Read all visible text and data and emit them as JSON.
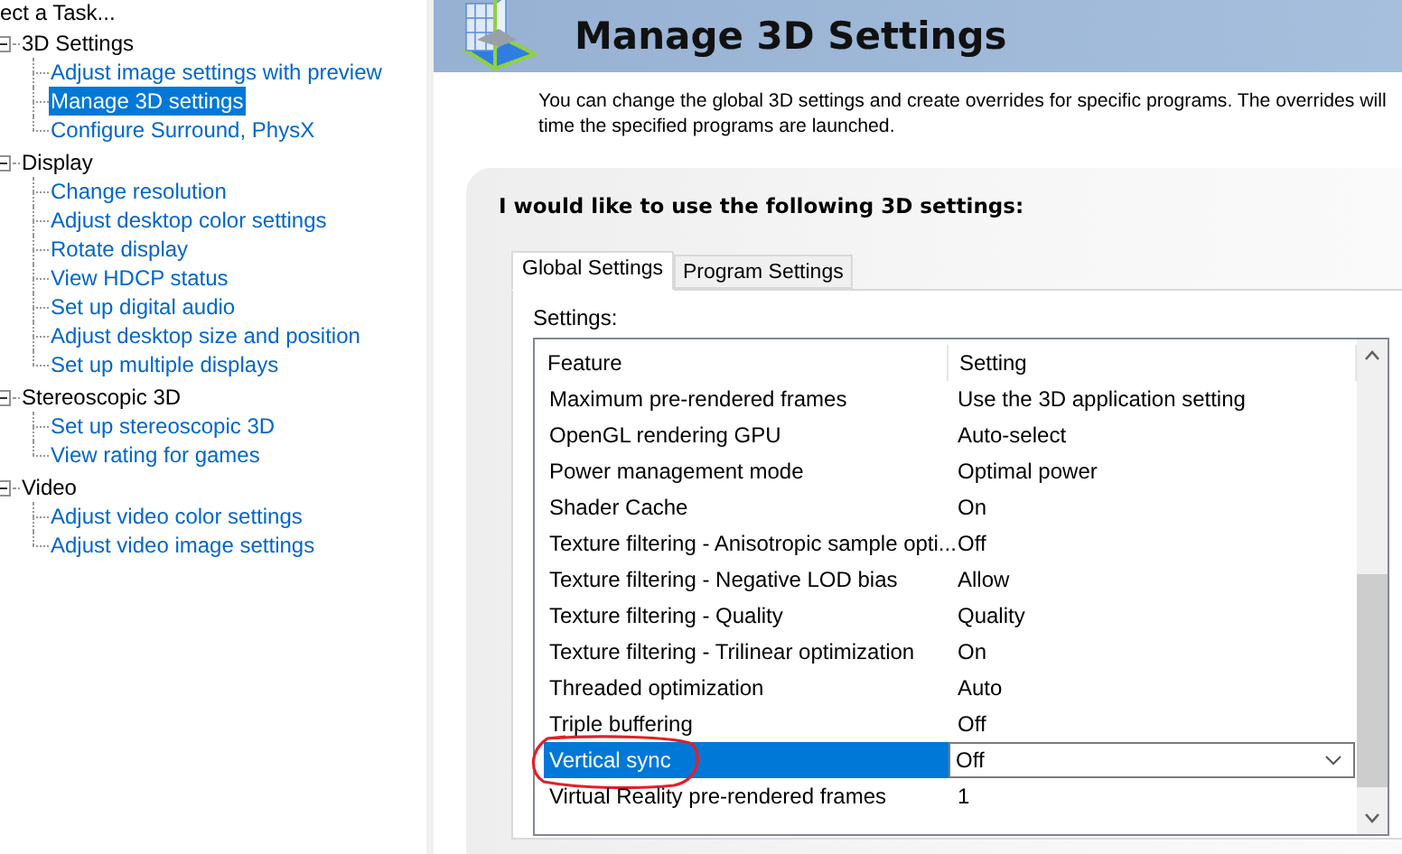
{
  "sidebar": {
    "caption": "ect a Task...",
    "tree": [
      {
        "label": "3D Settings",
        "expanded": true,
        "children": [
          {
            "label": "Adjust image settings with preview",
            "selected": false
          },
          {
            "label": "Manage 3D settings",
            "selected": true
          },
          {
            "label": "Configure Surround, PhysX",
            "selected": false
          }
        ]
      },
      {
        "label": "Display",
        "expanded": true,
        "children": [
          {
            "label": "Change resolution",
            "selected": false
          },
          {
            "label": "Adjust desktop color settings",
            "selected": false
          },
          {
            "label": "Rotate display",
            "selected": false
          },
          {
            "label": "View HDCP status",
            "selected": false
          },
          {
            "label": "Set up digital audio",
            "selected": false
          },
          {
            "label": "Adjust desktop size and position",
            "selected": false
          },
          {
            "label": "Set up multiple displays",
            "selected": false
          }
        ]
      },
      {
        "label": "Stereoscopic 3D",
        "expanded": true,
        "children": [
          {
            "label": "Set up stereoscopic 3D",
            "selected": false
          },
          {
            "label": "View rating for games",
            "selected": false
          }
        ]
      },
      {
        "label": "Video",
        "expanded": true,
        "children": [
          {
            "label": "Adjust video color settings",
            "selected": false
          },
          {
            "label": "Adjust video image settings",
            "selected": false
          }
        ]
      }
    ]
  },
  "page": {
    "title": "Manage 3D Settings",
    "description_lines": [
      "You can change the global 3D settings and create overrides for specific programs. The overrides will",
      "time the specified programs are launched."
    ],
    "section_heading": "I would like to use the following 3D settings:",
    "tabs": [
      {
        "label": "Global Settings",
        "selected": true
      },
      {
        "label": "Program Settings",
        "selected": false
      }
    ],
    "settings_label": "Settings:",
    "table": {
      "columns": [
        "Feature",
        "Setting"
      ],
      "rows": [
        {
          "feature": "Maximum pre-rendered frames",
          "setting": "Use the 3D application setting",
          "selected": false,
          "circled": false
        },
        {
          "feature": "OpenGL rendering GPU",
          "setting": "Auto-select",
          "selected": false,
          "circled": false
        },
        {
          "feature": "Power management mode",
          "setting": "Optimal power",
          "selected": false,
          "circled": false
        },
        {
          "feature": "Shader Cache",
          "setting": "On",
          "selected": false,
          "circled": false
        },
        {
          "feature": "Texture filtering - Anisotropic sample opti...",
          "setting": "Off",
          "selected": false,
          "circled": false
        },
        {
          "feature": "Texture filtering - Negative LOD bias",
          "setting": "Allow",
          "selected": false,
          "circled": false
        },
        {
          "feature": "Texture filtering - Quality",
          "setting": "Quality",
          "selected": false,
          "circled": false
        },
        {
          "feature": "Texture filtering - Trilinear optimization",
          "setting": "On",
          "selected": false,
          "circled": false
        },
        {
          "feature": "Threaded optimization",
          "setting": "Auto",
          "selected": false,
          "circled": false
        },
        {
          "feature": "Triple buffering",
          "setting": "Off",
          "selected": false,
          "circled": false
        },
        {
          "feature": "Vertical sync",
          "setting": "Off",
          "selected": true,
          "circled": true
        },
        {
          "feature": "Virtual Reality pre-rendered frames",
          "setting": "1",
          "selected": false,
          "circled": false
        }
      ]
    }
  }
}
